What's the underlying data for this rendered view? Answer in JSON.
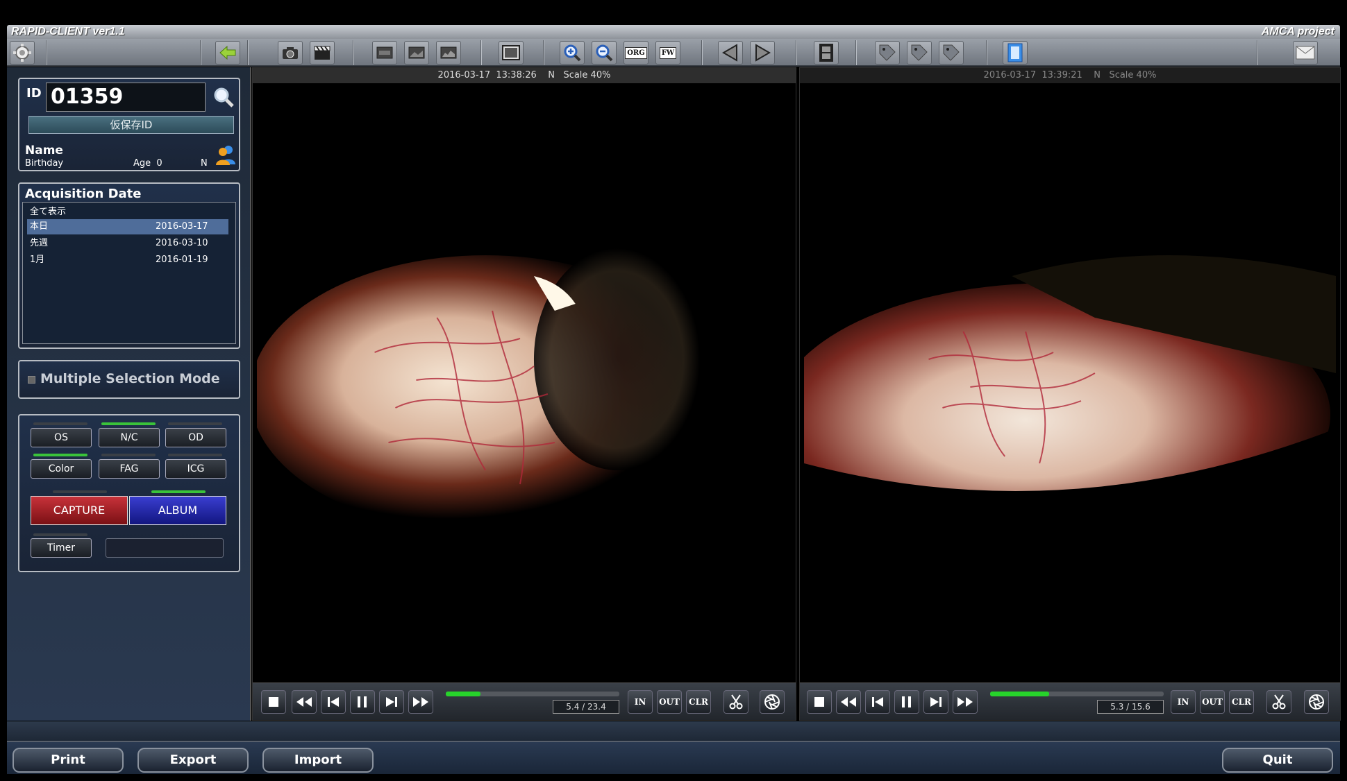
{
  "window": {
    "title": "RAPID-CLIENT ver1.1",
    "project": "AMCA project"
  },
  "toolbar": {
    "icons": [
      "gear-icon",
      "back-arrow-icon",
      "camera-icon",
      "clapperboard-icon",
      "layout-1-icon",
      "layout-2-icon",
      "layout-3-icon",
      "image-frame-icon",
      "zoom-in-icon",
      "zoom-out-icon",
      "org-icon",
      "fw-icon",
      "prev-icon",
      "next-icon",
      "film-icon",
      "tag-1-icon",
      "tag-2-icon",
      "tag-3-icon",
      "notebook-icon",
      "mail-icon"
    ],
    "org_label": "ORG",
    "fw_label": "FW"
  },
  "patient": {
    "id_label": "ID",
    "id_value": "01359",
    "temp_id_label": "仮保存ID",
    "name_label": "Name",
    "birthday_label": "Birthday",
    "age_label": "Age",
    "age_value": "0",
    "sex_value": "N"
  },
  "acquisition": {
    "title": "Acquisition Date",
    "rows": [
      {
        "label": "全て表示",
        "date": ""
      },
      {
        "label": "本日",
        "date": "2016-03-17"
      },
      {
        "label": "先週",
        "date": "2016-03-10"
      },
      {
        "label": "1月",
        "date": "2016-01-19"
      }
    ],
    "selected_index": 1
  },
  "multi_selection": {
    "label": "Multiple Selection Mode"
  },
  "controls": {
    "os": "OS",
    "nc": "N/C",
    "od": "OD",
    "color": "Color",
    "fag": "FAG",
    "icg": "ICG",
    "capture": "CAPTURE",
    "album": "ALBUM",
    "timer": "Timer"
  },
  "viewers": [
    {
      "date": "2016-03-17",
      "time": "13:38:26",
      "mode": "N",
      "scale": "Scale 40%",
      "time_display": "5.4 / 23.4",
      "progress": 0.2
    },
    {
      "date": "2016-03-17",
      "time": "13:39:21",
      "mode": "N",
      "scale": "Scale 40%",
      "time_display": "5.3 / 15.6",
      "progress": 0.34
    }
  ],
  "player": {
    "in": "IN",
    "out": "OUT",
    "clr": "CLR"
  },
  "bottom": {
    "print": "Print",
    "export": "Export",
    "import": "Import",
    "quit": "Quit"
  },
  "colors": {
    "capture": "#b02a30",
    "album": "#2a2eb8",
    "led_on": "#3ac33a",
    "progress": "#27d32b",
    "selected_row": "#4f6d9a"
  }
}
